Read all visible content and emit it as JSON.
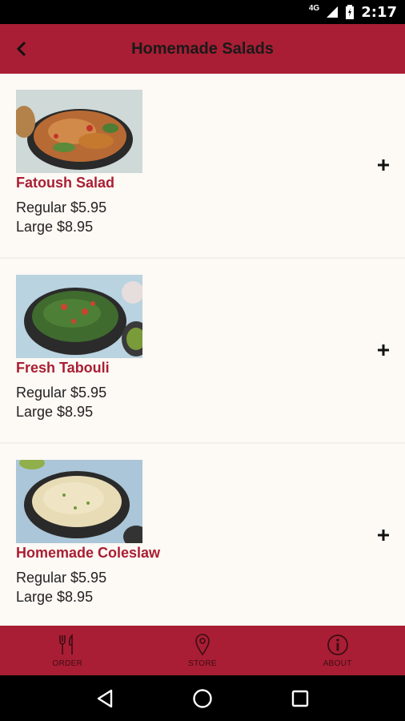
{
  "status_bar": {
    "network": "4G",
    "time": "2:17"
  },
  "header": {
    "title": "Homemade Salads"
  },
  "items": [
    {
      "name": "Fatoush Salad",
      "regular": "Regular $5.95",
      "large": "Large $8.95"
    },
    {
      "name": "Fresh Tabouli",
      "regular": "Regular $5.95",
      "large": "Large $8.95"
    },
    {
      "name": "Homemade Coleslaw",
      "regular": "Regular $5.95",
      "large": "Large $8.95"
    }
  ],
  "bottom_nav": [
    {
      "label": "ORDER",
      "icon": "fork-knife-icon"
    },
    {
      "label": "STORE",
      "icon": "location-pin-icon"
    },
    {
      "label": "ABOUT",
      "icon": "info-icon"
    }
  ],
  "colors": {
    "brand": "#a91e34",
    "background": "#fdf9f4",
    "item_name": "#a91e34"
  }
}
